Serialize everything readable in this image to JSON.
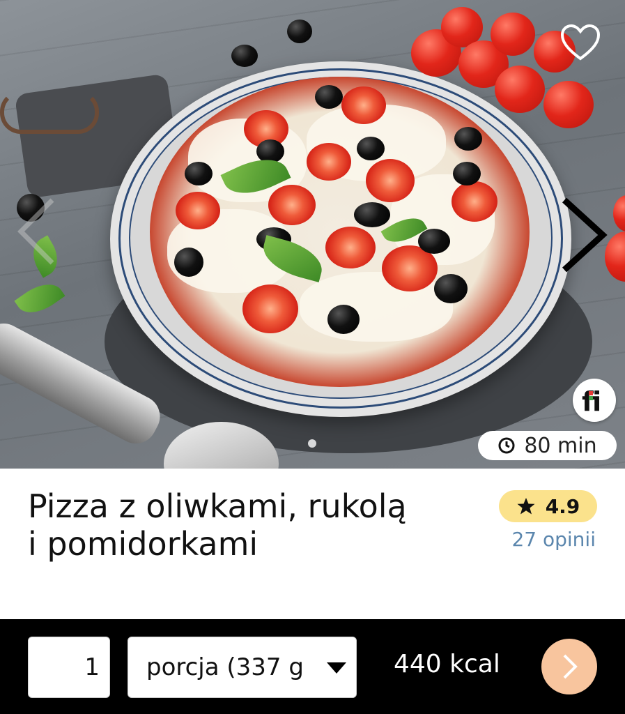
{
  "hero": {
    "favorite_icon": "heart-outline-icon",
    "next_icon": "chevron-right-icon",
    "prev_icon": "chevron-left-icon",
    "logo_text": "fi",
    "time_icon": "clock-icon",
    "time_text": "80 min"
  },
  "recipe": {
    "title_line1": "Pizza z oliwkami, rukolą",
    "title_line2": "i pomidorkami",
    "rating_icon": "star-icon",
    "rating": "4.9",
    "reviews": "27 opinii"
  },
  "bottom_bar": {
    "quantity": "1",
    "portion": "porcja (337 g",
    "kcal": "440 kcal",
    "next_icon": "chevron-right-icon"
  },
  "colors": {
    "rating_bg": "#fbe28c",
    "reviews_link": "#5b86ad",
    "next_button": "#f8c59e",
    "bar_bg": "#000000"
  }
}
